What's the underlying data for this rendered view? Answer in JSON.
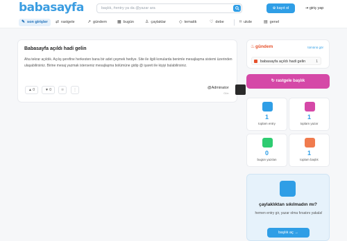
{
  "header": {
    "logo": "babasayfa",
    "search_placeholder": "başlık, #entry ya da @yazar ara",
    "register_label": "kayıt ol",
    "login_label": "giriş yap"
  },
  "nav": {
    "items": [
      {
        "label": "son girişler",
        "icon": "pencil-icon"
      },
      {
        "label": "rastgele",
        "icon": "shuffle-icon"
      },
      {
        "label": "gündem",
        "icon": "trending-icon"
      },
      {
        "label": "bugün",
        "icon": "calendar-icon"
      },
      {
        "label": "çaylaklar",
        "icon": "person-add-icon"
      },
      {
        "label": "tematik",
        "icon": "tag-icon"
      },
      {
        "label": "debe",
        "icon": "heart-icon"
      },
      {
        "label": "ukde",
        "icon": "bookmark-icon"
      },
      {
        "label": "genel",
        "icon": "grid-icon"
      }
    ]
  },
  "entry": {
    "title": "Babasayfa açıldı hadi gelin",
    "body": "Aha tekrar açıldık. Açılış şerefine herkesten bana bir adet çeşmek hediye. Site ile ilgili konularda benimle mesajlaşma sistemi üzerinden ulaşabilirsiniz. Birine mesaj yazmak isterseniz mesajlaşma bolümüne gidip @ işareti ile kişiyi bulabilirsiniz.",
    "upvotes": "0",
    "downvotes": "0",
    "author": "@Adminator",
    "date": "Gün"
  },
  "sidebar": {
    "gundem_title": "gündem",
    "gundem_more": "tümünü gör",
    "gundem_items": [
      {
        "label": "babasayfa açıldı hadi gelin",
        "count": "1"
      }
    ],
    "random_button": "rastgele başlık",
    "stats": [
      {
        "num": "1",
        "label": "toplam entry",
        "color": "#2f9ee6"
      },
      {
        "num": "1",
        "label": "toplam yazar",
        "color": "#d548a7"
      },
      {
        "num": "0",
        "label": "bugün yazılan",
        "color": "#2ecc71"
      },
      {
        "num": "1",
        "label": "toplam başlık",
        "color": "#f07b4e"
      }
    ],
    "promo": {
      "title": "çaylaklıktan sıkılmadın mı?",
      "subtitle": "hemen entry gir, yazar olma fırsatını yakala!",
      "button": "başlık aç"
    }
  },
  "colors": {
    "accent": "#2f9ee6",
    "pink": "#d548a7",
    "orange": "#e6512c"
  }
}
